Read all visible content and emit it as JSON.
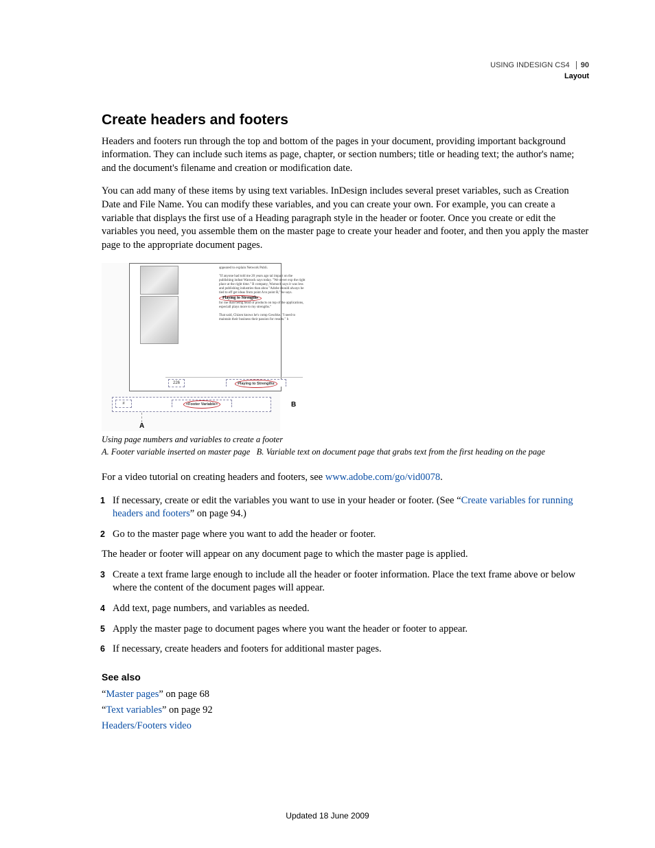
{
  "header": {
    "doc_title": "USING INDESIGN CS4",
    "page_number": "90",
    "section": "Layout"
  },
  "heading": "Create headers and footers",
  "para1": "Headers and footers run through the top and bottom of the pages in your document, providing important background information. They can include such items as page, chapter, or section numbers; title or heading text; the author's name; and the document's filename and creation or modification date.",
  "para2": "You can add many of these items by using text variables. InDesign includes several preset variables, such as Creation Date and File Name. You can modify these variables, and you can create your own. For example, you can create a variable that displays the first use of a Heading paragraph style in the header or footer. Once you create or edit the variables you need, you assemble them on the master page to create your header and footer, and then you apply the master page to the appropriate document pages.",
  "figure": {
    "sample_heading": "Playing to Strengths",
    "sample_pagenum": "226",
    "sample_footer_text": "Playing to Strengths",
    "master_footer_text": "<Footer Variable>",
    "label_a": "A",
    "label_b": "B"
  },
  "caption": "Using page numbers and variables to create a footer",
  "legend_a_label": "A.",
  "legend_a": "Footer variable inserted on master page",
  "legend_b_label": "B.",
  "legend_b": "Variable text on document page that grabs text from the first heading on the page",
  "video_intro": "For a video tutorial on creating headers and footers, see ",
  "video_link": "www.adobe.com/go/vid0078",
  "video_period": ".",
  "steps": [
    {
      "n": "1",
      "pre": "If necessary, create or edit the variables you want to use in your header or footer. (See “",
      "link": "Create variables for running headers and footers",
      "post": "” on page 94.)"
    },
    {
      "n": "2",
      "text": "Go to the master page where you want to add the header or footer."
    },
    {
      "n": "3",
      "text": "Create a text frame large enough to include all the header or footer information. Place the text frame above or below where the content of the document pages will appear."
    },
    {
      "n": "4",
      "text": "Add text, page numbers, and variables as needed."
    },
    {
      "n": "5",
      "text": "Apply the master page to document pages where you want the header or footer to appear."
    },
    {
      "n": "6",
      "text": "If necessary, create headers and footers for additional master pages."
    }
  ],
  "after_step2": "The header or footer will appear on any document page to which the master page is applied.",
  "see_also": {
    "title": "See also",
    "items": [
      {
        "q1": "“",
        "link": "Master pages",
        "q2": "” on page 68"
      },
      {
        "q1": "“",
        "link": "Text variables",
        "q2": "” on page 92"
      },
      {
        "link": "Headers/Footers video"
      }
    ]
  },
  "footer_update": "Updated 18 June 2009"
}
